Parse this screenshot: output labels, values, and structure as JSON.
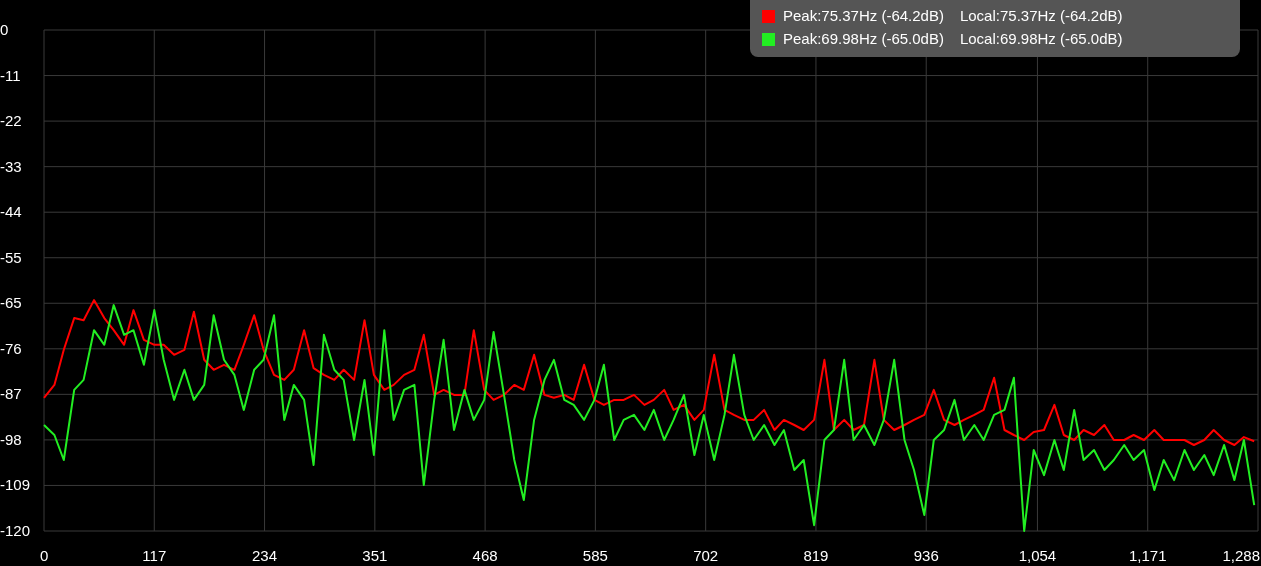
{
  "chart": {
    "legend": [
      {
        "color": "#ff0000",
        "peak": "Peak:75.37Hz (-64.2dB)",
        "local": "Local:75.37Hz (-64.2dB)"
      },
      {
        "color": "#22ee22",
        "peak": "Peak:69.98Hz (-65.0dB)",
        "local": "Local:69.98Hz (-65.0dB)"
      }
    ],
    "chart_data": {
      "type": "line",
      "xlim": [
        0,
        1288
      ],
      "ylim": [
        -120,
        0
      ],
      "grid": true,
      "xticks": [
        {
          "value": 0,
          "label": "0"
        },
        {
          "value": 117,
          "label": "117"
        },
        {
          "value": 234,
          "label": "234"
        },
        {
          "value": 351,
          "label": "351"
        },
        {
          "value": 468,
          "label": "468"
        },
        {
          "value": 585,
          "label": "585"
        },
        {
          "value": 702,
          "label": "702"
        },
        {
          "value": 819,
          "label": "819"
        },
        {
          "value": 936,
          "label": "936"
        },
        {
          "value": 1054,
          "label": "1,054"
        },
        {
          "value": 1171,
          "label": "1,171"
        },
        {
          "value": 1288,
          "label": "1,288"
        }
      ],
      "yticks": [
        {
          "value": 0,
          "label": "0"
        },
        {
          "value": -10.91,
          "label": "-11"
        },
        {
          "value": -21.82,
          "label": "-22"
        },
        {
          "value": -32.73,
          "label": "-33"
        },
        {
          "value": -43.64,
          "label": "-44"
        },
        {
          "value": -54.55,
          "label": "-55"
        },
        {
          "value": -65.45,
          "label": "-65"
        },
        {
          "value": -76.36,
          "label": "-76"
        },
        {
          "value": -87.27,
          "label": "-87"
        },
        {
          "value": -98.18,
          "label": "-98"
        },
        {
          "value": -109.09,
          "label": "-109"
        },
        {
          "value": -120,
          "label": "-120"
        }
      ],
      "x": [
        0,
        11,
        21,
        32,
        42,
        53,
        64,
        74,
        85,
        95,
        106,
        117,
        127,
        138,
        149,
        159,
        170,
        180,
        191,
        202,
        212,
        223,
        233,
        244,
        255,
        265,
        276,
        286,
        297,
        308,
        318,
        329,
        340,
        350,
        361,
        371,
        382,
        393,
        403,
        414,
        424,
        435,
        446,
        456,
        467,
        477,
        488,
        499,
        509,
        520,
        531,
        541,
        552,
        562,
        573,
        584,
        594,
        605,
        615,
        626,
        637,
        647,
        658,
        668,
        679,
        690,
        700,
        711,
        722,
        732,
        743,
        753,
        764,
        775,
        785,
        796,
        806,
        817,
        828,
        838,
        849,
        859,
        870,
        881,
        891,
        902,
        913,
        923,
        934,
        944,
        955,
        966,
        976,
        987,
        997,
        1008,
        1019,
        1029,
        1040,
        1050,
        1061,
        1072,
        1082,
        1093,
        1103,
        1114,
        1125,
        1135,
        1146,
        1156,
        1167,
        1178,
        1188,
        1199,
        1210,
        1220,
        1231,
        1241,
        1252,
        1263,
        1273,
        1284
      ],
      "series": [
        {
          "color": "#ff0000",
          "values": [
            -88.1,
            -85.0,
            -76.6,
            -69.0,
            -69.5,
            -64.7,
            -69.0,
            -71.9,
            -75.4,
            -67.1,
            -74.2,
            -75.4,
            -75.4,
            -77.8,
            -76.6,
            -67.5,
            -79.0,
            -81.4,
            -80.2,
            -81.4,
            -75.4,
            -68.3,
            -76.6,
            -82.6,
            -83.8,
            -81.4,
            -71.9,
            -81.0,
            -82.6,
            -83.8,
            -81.4,
            -83.8,
            -69.5,
            -82.6,
            -86.2,
            -85.0,
            -82.6,
            -81.4,
            -73.0,
            -87.4,
            -86.2,
            -87.4,
            -87.4,
            -71.9,
            -86.2,
            -88.6,
            -87.4,
            -85.0,
            -86.2,
            -77.8,
            -87.4,
            -88.1,
            -87.4,
            -88.6,
            -80.2,
            -88.6,
            -89.8,
            -88.6,
            -88.6,
            -87.4,
            -89.8,
            -88.6,
            -86.2,
            -91.0,
            -89.8,
            -93.4,
            -91.0,
            -77.8,
            -91.0,
            -92.2,
            -93.4,
            -93.4,
            -91.0,
            -95.8,
            -93.4,
            -94.6,
            -95.8,
            -93.4,
            -79.0,
            -95.8,
            -93.4,
            -95.8,
            -94.6,
            -79.0,
            -93.4,
            -95.8,
            -94.6,
            -93.4,
            -92.2,
            -86.2,
            -93.4,
            -94.6,
            -93.4,
            -92.2,
            -91.0,
            -83.3,
            -95.8,
            -97.0,
            -98.2,
            -96.3,
            -95.8,
            -89.8,
            -97.0,
            -98.2,
            -95.8,
            -97.0,
            -94.6,
            -98.2,
            -98.2,
            -97.0,
            -98.2,
            -95.8,
            -98.2,
            -98.2,
            -98.2,
            -99.4,
            -98.2,
            -95.8,
            -98.2,
            -99.4,
            -97.5,
            -98.5
          ]
        },
        {
          "color": "#22ee22",
          "values": [
            -94.6,
            -97.0,
            -103.0,
            -86.2,
            -83.8,
            -71.9,
            -75.4,
            -65.9,
            -73.0,
            -71.9,
            -80.2,
            -67.1,
            -79.0,
            -88.6,
            -81.4,
            -88.6,
            -85.0,
            -68.3,
            -79.0,
            -82.6,
            -91.0,
            -81.4,
            -79.0,
            -68.3,
            -93.4,
            -85.0,
            -88.6,
            -104.2,
            -73.0,
            -81.4,
            -83.8,
            -98.2,
            -83.8,
            -101.8,
            -71.9,
            -93.4,
            -86.2,
            -85.0,
            -109.0,
            -88.6,
            -74.2,
            -95.8,
            -86.2,
            -93.4,
            -88.6,
            -72.3,
            -87.4,
            -103.0,
            -112.6,
            -93.4,
            -83.8,
            -79.0,
            -88.6,
            -89.8,
            -93.4,
            -88.6,
            -80.2,
            -98.2,
            -93.4,
            -92.2,
            -95.8,
            -91.0,
            -98.2,
            -93.4,
            -87.4,
            -101.8,
            -92.2,
            -103.0,
            -92.2,
            -77.8,
            -92.2,
            -98.2,
            -94.6,
            -99.4,
            -95.8,
            -105.4,
            -103.0,
            -118.6,
            -98.2,
            -95.8,
            -79.0,
            -98.2,
            -94.6,
            -99.4,
            -93.4,
            -79.0,
            -98.2,
            -105.4,
            -116.2,
            -98.2,
            -95.8,
            -88.6,
            -98.2,
            -94.6,
            -98.2,
            -92.2,
            -91.0,
            -83.3,
            -120.0,
            -100.6,
            -106.6,
            -98.2,
            -105.4,
            -91.0,
            -103.0,
            -100.6,
            -105.4,
            -103.0,
            -99.4,
            -103.0,
            -100.6,
            -110.2,
            -103.0,
            -107.8,
            -100.6,
            -105.4,
            -101.8,
            -106.6,
            -99.4,
            -107.8,
            -98.2,
            -113.8
          ]
        }
      ]
    }
  }
}
